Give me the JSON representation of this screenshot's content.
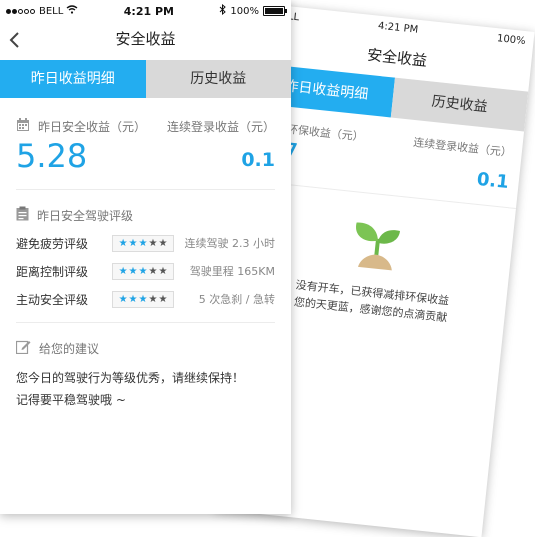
{
  "status": {
    "carrier": "BELL",
    "time": "4:21 PM",
    "battery": "100%"
  },
  "nav": {
    "title": "安全收益"
  },
  "tabs": [
    {
      "label": "昨日收益明细"
    },
    {
      "label": "历史收益"
    }
  ],
  "earnings": {
    "left_label": "昨日安全收益（元）",
    "right_label": "连续登录收益（元）",
    "left_value": "5.28",
    "right_value": "0.1"
  },
  "rating": {
    "title": "昨日安全驾驶评级",
    "rows": [
      {
        "name": "避免疲劳评级",
        "stars": 3,
        "detail": "连续驾驶 2.3 小时"
      },
      {
        "name": "距离控制评级",
        "stars": 3,
        "detail": "驾驶里程 165KM"
      },
      {
        "name": "主动安全评级",
        "stars": 3,
        "detail": "5 次急刹 / 急转"
      }
    ]
  },
  "advice": {
    "title": "给您的建议",
    "line1": "您今日的驾驶行为等级优秀，请继续保持！",
    "line2": "记得要平稳驾驶哦 ~"
  },
  "back_phone": {
    "carrier": "BELL",
    "time": "4:21 PM",
    "battery": "100%",
    "title": "安全收益",
    "tab_active": "昨日收益明细",
    "tab_inactive": "历史收益",
    "left_label": "减排环保收益（元）",
    "right_label": "连续登录收益（元）",
    "left_value": "07",
    "right_value": "0.1",
    "message_line1": "没有开车，已获得减排环保收益",
    "message_line2": "您的天更蓝，感谢您的点滴贡献"
  },
  "colors": {
    "accent": "#23adf0",
    "accent_text": "#1fa3e5",
    "tab_inactive": "#d9d9d9"
  }
}
